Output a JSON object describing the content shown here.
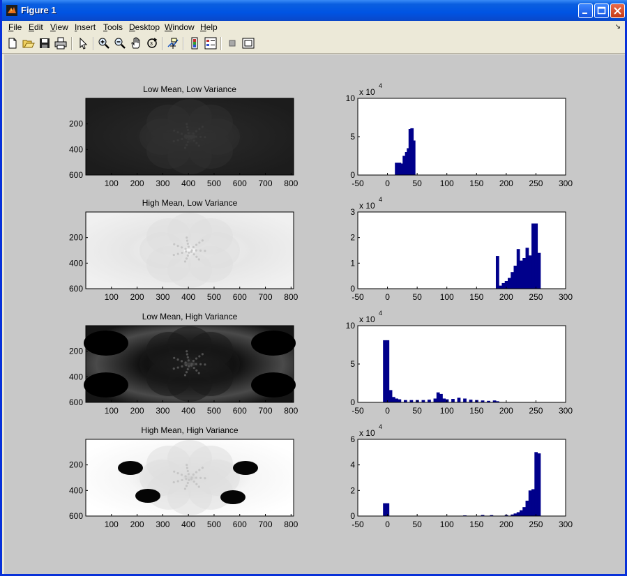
{
  "window": {
    "title": "Figure 1",
    "icon": "matlab-icon",
    "controls": [
      "minimize-icon",
      "maximize-icon",
      "close-icon"
    ]
  },
  "menu": [
    "File",
    "Edit",
    "View",
    "Insert",
    "Tools",
    "Desktop",
    "Window",
    "Help"
  ],
  "toolbar": [
    "new-figure-icon",
    "open-file-icon",
    "save-icon",
    "print-icon",
    "edit-plot-arrow-icon",
    "zoom-in-icon",
    "zoom-out-icon",
    "pan-hand-icon",
    "rotate-3d-icon",
    "data-cursor-icon",
    "insert-colorbar-icon",
    "insert-legend-icon",
    "hide-plot-tools-icon",
    "show-plot-tools-icon"
  ],
  "colors": {
    "bar": "#00008b",
    "figure_bg": "#c8c8c8",
    "title_bar": "#0054e3"
  },
  "chart_data": [
    {
      "type": "heatmap",
      "title": "Low Mean, Low Variance",
      "xticks": [
        100,
        200,
        300,
        400,
        500,
        600,
        700,
        800
      ],
      "yticks": [
        200,
        400,
        600
      ],
      "xlim": [
        0,
        810
      ],
      "ylim": [
        0,
        600
      ],
      "tone": "dark",
      "intensity_range": [
        15,
        45
      ]
    },
    {
      "type": "bar",
      "title": "",
      "exponent_label": "x 10",
      "exponent_power": "4",
      "xticks": [
        -50,
        0,
        50,
        100,
        150,
        200,
        250,
        300
      ],
      "yticks": [
        0,
        5,
        10
      ],
      "xlim": [
        -50,
        300
      ],
      "ylim": [
        0,
        10
      ],
      "bars": [
        [
          15,
          1.6
        ],
        [
          20,
          1.6
        ],
        [
          25,
          1.5
        ],
        [
          28,
          2.5
        ],
        [
          32,
          3.0
        ],
        [
          35,
          3.5
        ],
        [
          38,
          6.0
        ],
        [
          41,
          6.1
        ],
        [
          44,
          4.5
        ]
      ]
    },
    {
      "type": "heatmap",
      "title": "High Mean, Low Variance",
      "xticks": [
        100,
        200,
        300,
        400,
        500,
        600,
        700,
        800
      ],
      "yticks": [
        200,
        400,
        600
      ],
      "xlim": [
        0,
        810
      ],
      "ylim": [
        0,
        600
      ],
      "tone": "light",
      "intensity_range": [
        185,
        255
      ]
    },
    {
      "type": "bar",
      "title": "",
      "exponent_label": "x 10",
      "exponent_power": "4",
      "xticks": [
        -50,
        0,
        50,
        100,
        150,
        200,
        250,
        300
      ],
      "yticks": [
        0,
        1,
        2,
        3
      ],
      "xlim": [
        -50,
        300
      ],
      "ylim": [
        0,
        3
      ],
      "bars": [
        [
          185,
          1.28
        ],
        [
          190,
          0.12
        ],
        [
          195,
          0.22
        ],
        [
          200,
          0.3
        ],
        [
          205,
          0.42
        ],
        [
          210,
          0.65
        ],
        [
          215,
          0.9
        ],
        [
          220,
          1.55
        ],
        [
          225,
          1.1
        ],
        [
          230,
          1.2
        ],
        [
          235,
          1.6
        ],
        [
          240,
          1.3
        ],
        [
          245,
          2.55
        ],
        [
          250,
          2.55
        ],
        [
          255,
          1.4
        ]
      ]
    },
    {
      "type": "heatmap",
      "title": "Low Mean, High Variance",
      "xticks": [
        100,
        200,
        300,
        400,
        500,
        600,
        700,
        800
      ],
      "yticks": [
        200,
        400,
        600
      ],
      "xlim": [
        0,
        810
      ],
      "ylim": [
        0,
        600
      ],
      "tone": "contrast-dark",
      "intensity_range": [
        0,
        200
      ]
    },
    {
      "type": "bar",
      "title": "",
      "exponent_label": "x 10",
      "exponent_power": "4",
      "xticks": [
        -50,
        0,
        50,
        100,
        150,
        200,
        250,
        300
      ],
      "yticks": [
        0,
        5,
        10
      ],
      "xlim": [
        -50,
        300
      ],
      "ylim": [
        0,
        10
      ],
      "bars": [
        [
          -5,
          8.1
        ],
        [
          0,
          8.1
        ],
        [
          5,
          1.6
        ],
        [
          10,
          0.7
        ],
        [
          15,
          0.5
        ],
        [
          20,
          0.4
        ],
        [
          30,
          0.3
        ],
        [
          40,
          0.3
        ],
        [
          50,
          0.3
        ],
        [
          60,
          0.3
        ],
        [
          70,
          0.35
        ],
        [
          80,
          0.5
        ],
        [
          85,
          1.3
        ],
        [
          90,
          1.1
        ],
        [
          95,
          0.5
        ],
        [
          100,
          0.4
        ],
        [
          110,
          0.45
        ],
        [
          120,
          0.6
        ],
        [
          130,
          0.5
        ],
        [
          140,
          0.35
        ],
        [
          150,
          0.3
        ],
        [
          160,
          0.25
        ],
        [
          170,
          0.2
        ],
        [
          180,
          0.25
        ],
        [
          185,
          0.15
        ]
      ]
    },
    {
      "type": "heatmap",
      "title": "High Mean, High Variance",
      "xticks": [
        100,
        200,
        300,
        400,
        500,
        600,
        700,
        800
      ],
      "yticks": [
        200,
        400,
        600
      ],
      "xlim": [
        0,
        810
      ],
      "ylim": [
        0,
        600
      ],
      "tone": "contrast-light",
      "intensity_range": [
        0,
        255
      ]
    },
    {
      "type": "bar",
      "title": "",
      "exponent_label": "x 10",
      "exponent_power": "4",
      "xticks": [
        -50,
        0,
        50,
        100,
        150,
        200,
        250,
        300
      ],
      "yticks": [
        0,
        2,
        4,
        6
      ],
      "xlim": [
        -50,
        300
      ],
      "ylim": [
        0,
        6
      ],
      "bars": [
        [
          -5,
          1.0
        ],
        [
          0,
          1.0
        ],
        [
          130,
          0.05
        ],
        [
          160,
          0.08
        ],
        [
          175,
          0.07
        ],
        [
          200,
          0.08
        ],
        [
          210,
          0.12
        ],
        [
          215,
          0.2
        ],
        [
          220,
          0.3
        ],
        [
          225,
          0.45
        ],
        [
          230,
          0.7
        ],
        [
          235,
          1.2
        ],
        [
          240,
          2.0
        ],
        [
          245,
          2.1
        ],
        [
          250,
          5.0
        ],
        [
          255,
          4.9
        ]
      ]
    }
  ]
}
